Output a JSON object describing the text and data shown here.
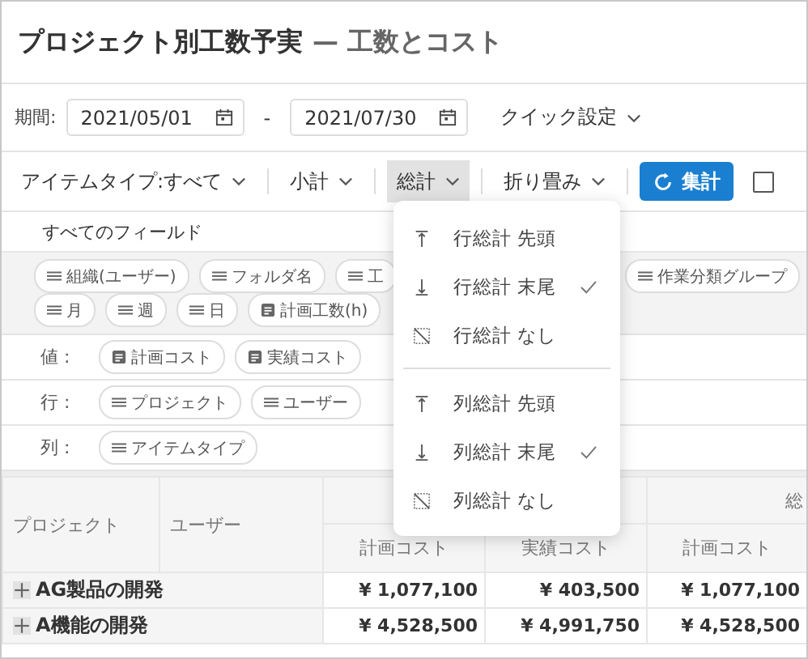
{
  "title": "プロジェクト別工数予実",
  "subtitle": "— 工数とコスト",
  "period": {
    "label": "期間:",
    "start": "2021/05/01",
    "separator": "-",
    "end": "2021/07/30",
    "quick": "クイック設定"
  },
  "toolbar": [
    {
      "kind": "dropdown",
      "label": "アイテムタイプ:すべて",
      "selected": false
    },
    {
      "kind": "dropdown",
      "label": "小計",
      "selected": false
    },
    {
      "kind": "dropdown",
      "label": "総計",
      "selected": true
    },
    {
      "kind": "dropdown",
      "label": "折り畳み",
      "selected": false
    },
    {
      "kind": "primary",
      "label": "集計"
    },
    {
      "kind": "checkbox",
      "checked": false
    }
  ],
  "fields": {
    "title": "すべてのフィールド",
    "chips": [
      {
        "label": "組織(ユーザー)",
        "kind": "dimension"
      },
      {
        "label": "フォルダ名",
        "kind": "dimension"
      },
      {
        "label": "工",
        "kind": "dimension"
      },
      {
        "label": "作業分類グループ",
        "kind": "dimension"
      },
      {
        "label": "月",
        "kind": "dimension"
      },
      {
        "label": "週",
        "kind": "dimension"
      },
      {
        "label": "日",
        "kind": "dimension"
      },
      {
        "label": "計画工数(h)",
        "kind": "measure"
      }
    ]
  },
  "zones": [
    {
      "label": "値 :",
      "chips": [
        {
          "label": "計画コスト",
          "kind": "measure"
        },
        {
          "label": "実績コスト",
          "kind": "measure"
        }
      ]
    },
    {
      "label": "行 :",
      "chips": [
        {
          "label": "プロジェクト",
          "kind": "dimension"
        },
        {
          "label": "ユーザー",
          "kind": "dimension"
        }
      ]
    },
    {
      "label": "列 :",
      "chips": [
        {
          "label": "アイテムタイプ",
          "kind": "dimension"
        }
      ]
    }
  ],
  "table": {
    "row_headers": [
      "プロジェクト",
      "ユーザー"
    ],
    "group_header": "総",
    "columns": [
      "計画コスト",
      "実績コスト",
      "計画コスト"
    ],
    "rows": [
      {
        "project": "AG製品の開発",
        "expanded": false,
        "cells": [
          "¥ 1,077,100",
          "¥ 403,500",
          "¥ 1,077,100"
        ]
      },
      {
        "project": "A機能の開発",
        "expanded": false,
        "cells": [
          "¥ 4,528,500",
          "¥ 4,991,750",
          "¥ 4,528,500"
        ]
      }
    ]
  },
  "menu": [
    {
      "label": "行総計 先頭",
      "kind": "top",
      "checked": false
    },
    {
      "label": "行総計 末尾",
      "kind": "bottom",
      "checked": true
    },
    {
      "label": "行総計 なし",
      "kind": "none",
      "checked": false
    },
    {
      "kind": "divider"
    },
    {
      "label": "列総計 先頭",
      "kind": "top",
      "checked": false
    },
    {
      "label": "列総計 末尾",
      "kind": "bottom",
      "checked": true
    },
    {
      "label": "列総計 なし",
      "kind": "none",
      "checked": false
    }
  ]
}
